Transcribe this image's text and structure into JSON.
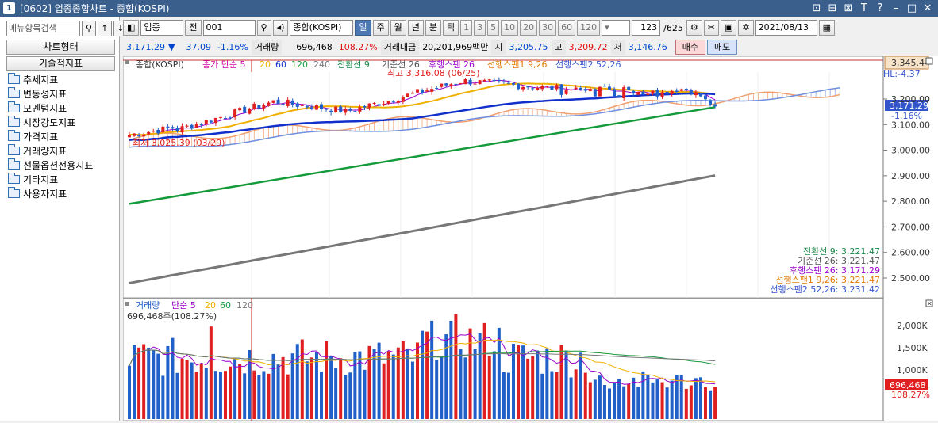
{
  "window": {
    "number": "1",
    "title": "[0602] 업종종합차트 - 종합(KOSPI)",
    "controls": [
      "⊡",
      "⊟",
      "⊠",
      "Τ",
      "?",
      "–",
      "□",
      "✕"
    ]
  },
  "left_panel": {
    "search_placeholder": "메뉴항목검색",
    "chart_type_label": "차트형태",
    "tech_indicator_label": "기술적지표",
    "tree": [
      "추세지표",
      "변동성지표",
      "모멘텀지표",
      "시장강도지표",
      "가격지표",
      "거래량지표",
      "선물옵션전용지표",
      "기타지표",
      "사용자지표"
    ]
  },
  "toolbar": {
    "market": "업종",
    "prev": "전",
    "code": "001",
    "name": "종합(KOSPI)",
    "periods": [
      "일",
      "주",
      "월",
      "년",
      "분",
      "틱"
    ],
    "minutes": [
      "1",
      "3",
      "5",
      "10",
      "20",
      "30",
      "60",
      "120"
    ],
    "count": "123",
    "total": "/625",
    "date": "2021/08/13"
  },
  "quote": {
    "price": "3,171.29",
    "arrow": "▼",
    "change": "37.09",
    "change_pct": "-1.16%",
    "volume_label": "거래량",
    "volume": "696,468",
    "volume_ratio": "108.27%",
    "amount_label": "거래대금",
    "amount": "20,201,969백만",
    "open_label": "시",
    "open": "3,205.75",
    "high_label": "고",
    "high": "3,209.72",
    "low_label": "저",
    "low": "3,146.76",
    "buy": "매수",
    "sell": "매도"
  },
  "price_chart": {
    "legend": {
      "title": "종합(KOSPI)",
      "ma_label": "종가 단순 5",
      "ma_periods": [
        "20",
        "60",
        "120",
        "240"
      ],
      "ichimoku": [
        "전환선 9",
        "기준선 26",
        "후행스팬 26",
        "선행스팬1 9,26",
        "선행스팬2 52,26"
      ]
    },
    "high_note": "최고 3,316.08 (06/25)",
    "low_note": "최저 3,025.39 (03/29)",
    "right_labels": {
      "top": "3,345.44",
      "hl": "HL:-4.37",
      "current": "3,171.29",
      "pct": "-1.16%"
    },
    "y_ticks": [
      "3,200.00",
      "3,100.00",
      "3,000.00",
      "2,900.00",
      "2,800.00",
      "2,700.00",
      "2,600.00",
      "2,500.00"
    ],
    "ichimoku_values": [
      {
        "label": "전환선 9: 3,221.47",
        "color": "#1a8a4a"
      },
      {
        "label": "기준선 26: 3,221.47",
        "color": "#555555"
      },
      {
        "label": "후행스팬 26: 3,171.29",
        "color": "#9900cc"
      },
      {
        "label": "선행스팬1 9,26: 3,221.47",
        "color": "#e07a00"
      },
      {
        "label": "선행스팬2 52,26: 3,231.42",
        "color": "#3355cc"
      }
    ],
    "colors": {
      "up": "#e02020",
      "down": "#2060c8",
      "ma5": "#9900cc",
      "ma20": "#f0b000",
      "ma60": "#1030cc",
      "ma120": "#159a3a",
      "ma240": "#777777",
      "span1": "#f0a070",
      "span2": "#6f8fe0"
    }
  },
  "volume_chart": {
    "legend_title": "거래량",
    "ma_label": "단순 5",
    "ma_periods": [
      "20",
      "60",
      "120"
    ],
    "current_label": "696,468주(108.27%)",
    "y_ticks": [
      "2,000K",
      "1,500K",
      "1,000K"
    ],
    "right_labels": {
      "value": "696,468",
      "pct": "108.27%"
    }
  }
}
